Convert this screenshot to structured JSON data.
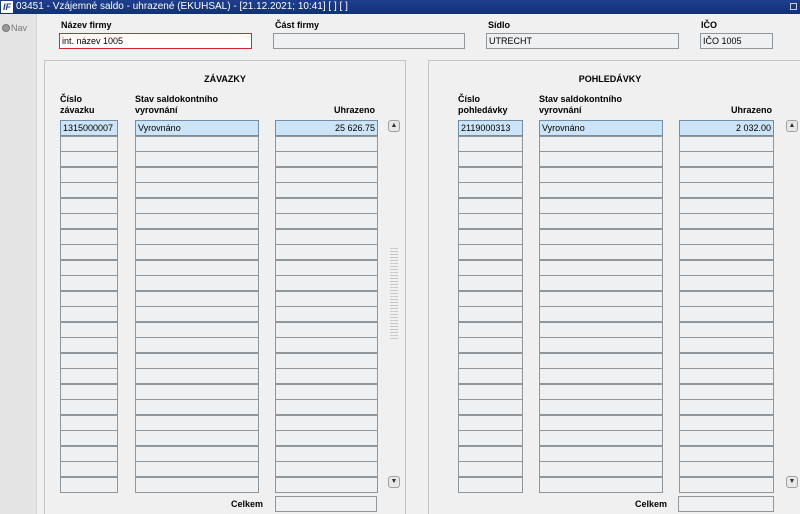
{
  "window": {
    "title": "03451 - Vzájemné saldo - uhrazené (EKUHSAL) - [21.12.2021; 10:41]  [ ]  [ ]",
    "logo": "IF"
  },
  "nav": {
    "label": "Nav"
  },
  "header": {
    "company_name_label": "Název firmy",
    "company_name_value": "int. název 1005",
    "company_part_label": "Část firmy",
    "company_part_value": "",
    "seat_label": "Sídlo",
    "seat_value": "UTRECHT",
    "ico_label": "IČO",
    "ico_value": "IČO 1005"
  },
  "liabilities": {
    "title": "ZÁVAZKY",
    "col_number": "Číslo\nzávazku",
    "col_number_l1": "Číslo",
    "col_number_l2": "závazku",
    "col_status_l1": "Stav saldokontního",
    "col_status_l2": "vyrovnání",
    "col_paid": "Uhrazeno",
    "rows": [
      {
        "number": "1315000007",
        "status": "Vyrovnáno",
        "paid": "25 626.75"
      }
    ],
    "total_label": "Celkem",
    "total_value": ""
  },
  "receivables": {
    "title": "POHLEDÁVKY",
    "col_number_l1": "Číslo",
    "col_number_l2": "pohledávky",
    "col_status_l1": "Stav saldokontního",
    "col_status_l2": "vyrovnání",
    "col_paid": "Uhrazeno",
    "rows": [
      {
        "number": "2119000313",
        "status": "Vyrovnáno",
        "paid": "2 032.00"
      }
    ],
    "total_label": "Celkem",
    "total_value": ""
  },
  "scroll": {
    "up_icon": "arrow-up-icon",
    "down_icon": "arrow-down-icon"
  },
  "grid_visible_rows": 24
}
